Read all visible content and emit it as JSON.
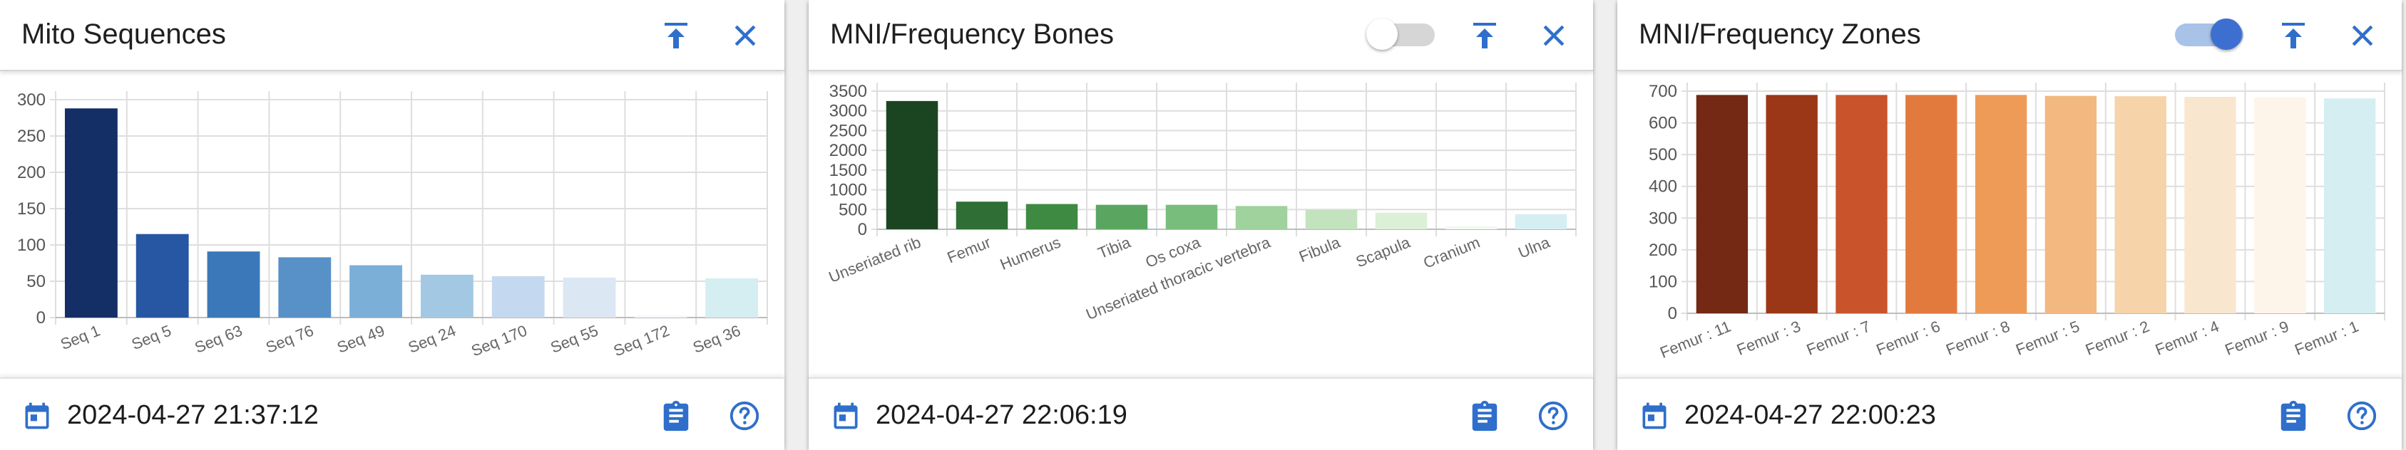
{
  "panels": [
    {
      "title": "Mito Sequences",
      "has_toggle": false,
      "date": "2024-04-27 21:37:12",
      "chart_data": {
        "type": "bar",
        "categories": [
          "Seq 1",
          "Seq 5",
          "Seq 63",
          "Seq 76",
          "Seq 49",
          "Seq 24",
          "Seq 170",
          "Seq 55",
          "Seq 172",
          "Seq 36"
        ],
        "values": [
          288,
          115,
          91,
          83,
          72,
          59,
          57,
          55,
          3,
          54
        ],
        "ylim": [
          0,
          300
        ],
        "yticks": [
          0,
          50,
          100,
          150,
          200,
          250,
          300
        ],
        "colors": [
          "#142e66",
          "#2756a2",
          "#3a78ba",
          "#5791c8",
          "#7bafd8",
          "#a3c8e4",
          "#c4d9ef",
          "#dce7f4",
          "#f5f8fd",
          "#d5eef2"
        ],
        "grid": true
      }
    },
    {
      "title": "MNI/Frequency Bones",
      "has_toggle": true,
      "toggle_on": false,
      "date": "2024-04-27 22:06:19",
      "chart_data": {
        "type": "bar",
        "categories": [
          "Unseriated rib",
          "Femur",
          "Humerus",
          "Tibia",
          "Os coxa",
          "Unseriated thoracic vertebra",
          "Fibula",
          "Scapula",
          "Cranium",
          "Ulna"
        ],
        "values": [
          3250,
          700,
          640,
          620,
          620,
          590,
          490,
          420,
          80,
          380
        ],
        "ylim": [
          0,
          3500
        ],
        "yticks": [
          0,
          500,
          1000,
          1500,
          2000,
          2500,
          3000,
          3500
        ],
        "colors": [
          "#1b4521",
          "#2f6e34",
          "#3e8a43",
          "#5aa661",
          "#79bd7c",
          "#9fd29c",
          "#c2e3bd",
          "#dcefd7",
          "#f2f9f1",
          "#d5eef2"
        ],
        "grid": true
      }
    },
    {
      "title": "MNI/Frequency Zones",
      "has_toggle": true,
      "toggle_on": true,
      "date": "2024-04-27 22:00:23",
      "chart_data": {
        "type": "bar",
        "categories": [
          "Femur : 11",
          "Femur : 3",
          "Femur : 7",
          "Femur : 6",
          "Femur : 8",
          "Femur : 5",
          "Femur : 2",
          "Femur : 4",
          "Femur : 9",
          "Femur : 1"
        ],
        "values": [
          688,
          688,
          688,
          688,
          688,
          685,
          684,
          682,
          680,
          677
        ],
        "ylim": [
          0,
          700
        ],
        "yticks": [
          0,
          100,
          200,
          300,
          400,
          500,
          600,
          700
        ],
        "colors": [
          "#732913",
          "#9b3716",
          "#c9532a",
          "#e27a3e",
          "#ef9b58",
          "#f2b87f",
          "#f6d3a8",
          "#f9e6cf",
          "#fdf4ea",
          "#d5eef2"
        ],
        "grid": true
      }
    }
  ],
  "icons": {
    "move_top": "vertical-align-top-icon",
    "close": "close-icon",
    "calendar": "calendar-icon",
    "clipboard": "clipboard-icon",
    "help": "help-circle-icon"
  },
  "theme": {
    "accent": "#2f6fcb",
    "grid": "#dedede",
    "axis_text": "#666666"
  }
}
